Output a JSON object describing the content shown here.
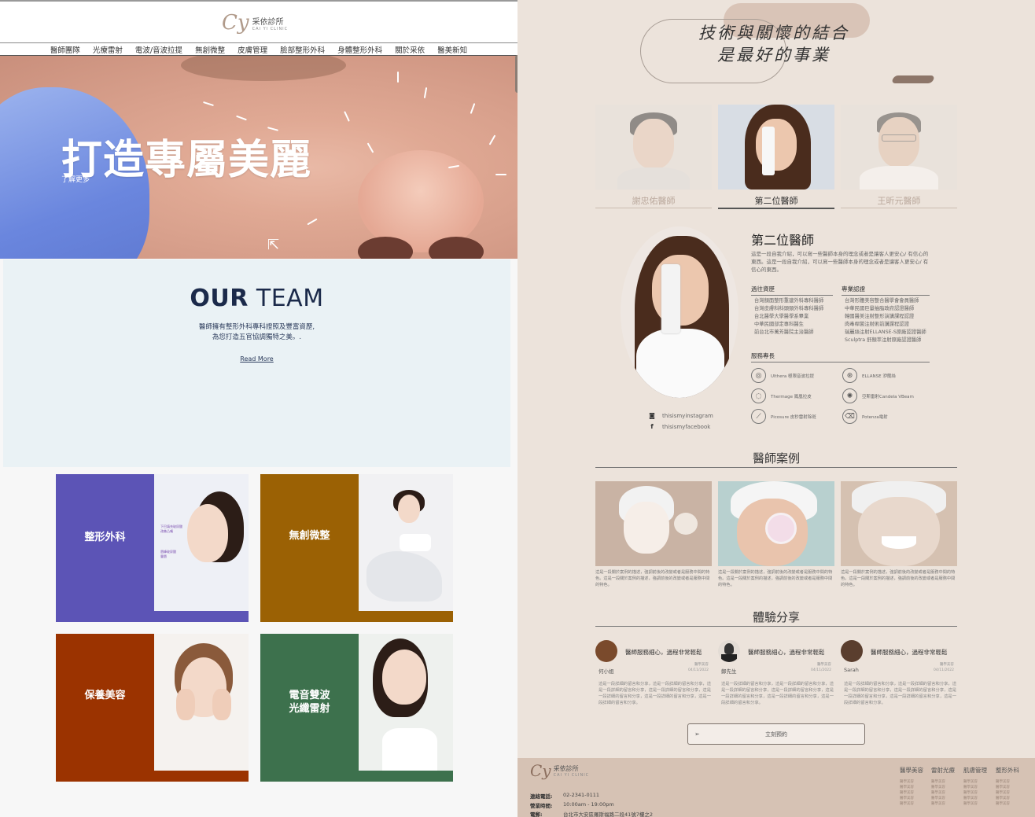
{
  "left": {
    "logo": {
      "mark": "Cy",
      "name": "采依診所",
      "sub": "CAI YI CLINIC"
    },
    "nav": [
      "醫師團隊",
      "光療雷射",
      "電波/音波拉提",
      "無創微整",
      "皮膚管理",
      "臉部整形外科",
      "身體整形外科",
      "關於采依",
      "醫美新知"
    ],
    "hero": {
      "title": "打造專屬美麗",
      "link": "了解更多"
    },
    "team": {
      "title_bold": "OUR",
      "title_light": " TEAM",
      "desc_line1": "醫師擁有整形外科專科證照及豐富資歷,",
      "desc_line2": "為您打造五官協調獨特之美。.",
      "link": "Read More"
    },
    "cards": [
      {
        "label": "整形外科",
        "color": "#5c54b6"
      },
      {
        "label": "無創微整",
        "color": "#9b6104"
      },
      {
        "label": "保養美容",
        "color": "#9b3300"
      },
      {
        "label": "電音雙波\n光纖雷射",
        "label1": "電音雙波",
        "label2": "光纖雷射",
        "color": "#3d714d"
      }
    ],
    "card1_tags": [
      "下巴填充玻尿酸\n改善凸嘴",
      "唇峰玻尿酸\n豐唇"
    ]
  },
  "right": {
    "quote_line1": "技術與關懷的結合",
    "quote_line2": "是最好的事業",
    "doctors": [
      {
        "name": "謝忠佑醫師",
        "active": false
      },
      {
        "name": "第二位醫師",
        "active": true
      },
      {
        "name": "王昕元醫師",
        "active": false
      }
    ],
    "profile": {
      "title": "第二位醫師",
      "intro": "這是一段自我介紹，可以寫一些醫師本身的理念或者是讓客人更安心/ 有信心的東西。這是一段自我介紹，可以寫一些醫師本身的理念或者是讓客人更安心/ 有信心的東西。",
      "exp_head": "過往資歷",
      "exp": [
        "台灣顏面整形重建外科專科醫師",
        "台灣皮膚科科頭頸外科專科醫師",
        "台北醫學大學醫學系畢業",
        "中華民國部定專科醫生",
        "前台北市萬芳醫院主治醫師"
      ],
      "cert_head": "專業認證",
      "cert": [
        "台灣形體美容整合醫學會會員醫師",
        "中華民國巨量抽脂政府認證醫師",
        "韓國醫美注射整形演講課程認證",
        "肉毒桿菌注射術前講課程認證",
        "瑞麗絲注射ELLANSE-S原廠認證醫師",
        "Sculptra 舒顏萃注射原廠認證醫師"
      ],
      "skills_head": "服務專長",
      "skills": [
        {
          "icon": "ultherapy-icon",
          "glyph": "◎",
          "label": "Ulthera 極限音波拉提"
        },
        {
          "icon": "ellanse-icon",
          "glyph": "⊛",
          "label": "ELLANSE 洢蘭絲"
        },
        {
          "icon": "thermage-icon",
          "glyph": "◌",
          "label": "Thermage 鳳凰拉皮"
        },
        {
          "icon": "candela-icon",
          "glyph": "✺",
          "label": "亞斯雷射Candela VBeam"
        },
        {
          "icon": "picosure-icon",
          "glyph": "⟋",
          "label": "Picosure 皮秒雷射除斑"
        },
        {
          "icon": "potenza-icon",
          "glyph": "⌫",
          "label": "Potenza電射"
        }
      ],
      "instagram": "thisismyinstagram",
      "facebook": "thisismyfacebook"
    },
    "cases_title": "醫師案例",
    "cases": [
      {
        "text": "這是一段關於案例的描述，強調前後的改變或者是服務中間的特色。這是一段關於案例的描述，強調前後的改變或者是服務中間的特色。"
      },
      {
        "text": "這是一段關於案例的描述，強調前後的改變或者是服務中間的特色。這是一段關於案例的描述，強調前後的改變或者是服務中間的特色。"
      },
      {
        "text": "這是一段關於案例的描述，強調前後的改變或者是服務中間的特色。這是一段關於案例的描述，強調前後的改變或者是服務中間的特色。"
      }
    ],
    "reviews_title": "體驗分享",
    "reviews": [
      {
        "title": "醫師服務細心，過程非常輕鬆",
        "who": "何小姐",
        "meta1": "醫學美容",
        "meta2": "04/11/2022",
        "body": "這是一段詳細的留言和分享，這是一段詳細的留言和分享，這是一段詳細的留言和分享，這是一段詳細的留言和分享，這是一段詳細的留言和分享，這是一段詳細的留言和分享，這是一段詳細的留言和分享。"
      },
      {
        "title": "醫師服務細心，過程非常輕鬆",
        "who": "鄭先生",
        "meta1": "醫學美容",
        "meta2": "04/11/2022",
        "body": "這是一段詳細的留言和分享，這是一段詳細的留言和分享，這是一段詳細的留言和分享，這是一段詳細的留言和分享，這是一段詳細的留言和分享，這是一段詳細的留言和分享，這是一段詳細的留言和分享。"
      },
      {
        "title": "醫師服務細心，過程非常輕鬆",
        "who": "Sarah",
        "meta1": "醫學美容",
        "meta2": "04/11/2022",
        "body": "這是一段詳細的留言和分享，這是一段詳細的留言和分享，這是一段詳細的留言和分享，這是一段詳細的留言和分享，這是一段詳細的留言和分享，這是一段詳細的留言和分享，這是一段詳細的留言和分享。"
      }
    ],
    "book_button": "立刻預約",
    "footer": {
      "logo_mark": "Cy",
      "logo_name": "采依診所",
      "logo_sub": "CAI YI CLINIC",
      "phone_label": "連絡電話:",
      "phone": "02-2341-0111",
      "hours_label": "營業時間:",
      "hours": "10:00am - 19:00pm",
      "addr_label": "電郵:",
      "addr": "台北市大安區羅斯福路二段41號7樓之2",
      "cols": [
        {
          "head": "醫學美容",
          "items": [
            "醫學美容",
            "醫學美容",
            "醫學美容",
            "醫學美容",
            "醫學美容"
          ]
        },
        {
          "head": "雷射光療",
          "items": [
            "醫學美容",
            "醫學美容",
            "醫學美容",
            "醫學美容",
            "醫學美容"
          ]
        },
        {
          "head": "肌膚管理",
          "items": [
            "醫學美容",
            "醫學美容",
            "醫學美容",
            "醫學美容",
            "醫學美容"
          ]
        },
        {
          "head": "整形外科",
          "items": [
            "醫學美容",
            "醫學美容",
            "醫學美容",
            "醫學美容",
            "醫學美容"
          ]
        }
      ]
    }
  }
}
